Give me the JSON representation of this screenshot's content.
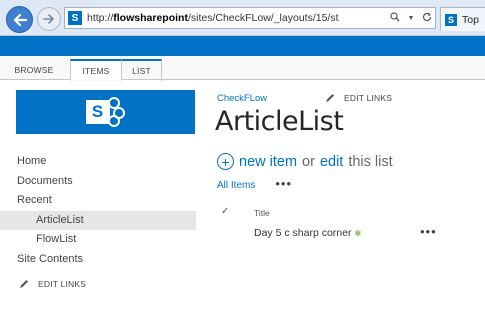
{
  "browser": {
    "url_prefix": "http://",
    "url_domain": "flowsharepoint",
    "url_rest": "/sites/CheckFLow/_layouts/15/st",
    "search_icon": "search-icon",
    "refresh_icon": "refresh-icon",
    "tab_label": "Top",
    "favicon_letter": "S"
  },
  "ribbon": {
    "tabs": [
      "BROWSE",
      "ITEMS",
      "LIST"
    ]
  },
  "site": {
    "logo_letter": "S",
    "crumb": "CheckFLow",
    "edit_links": "EDIT LINKS"
  },
  "quicklaunch": {
    "items": [
      "Home",
      "Documents",
      "Recent",
      "ArticleList",
      "FlowList",
      "Site Contents"
    ],
    "edit_links": "EDIT LINKS"
  },
  "main": {
    "page_title": "ArticleList",
    "new_item": "new item",
    "or": "or",
    "edit": "edit",
    "this_list": "this list",
    "plus": "+",
    "view_name": "All Items",
    "view_more": "•••",
    "header_check": "✓",
    "header_title": "Title",
    "rows": [
      {
        "title": "Day 5 c sharp corner",
        "badge": "✻",
        "menu": "•••"
      }
    ]
  },
  "colors": {
    "accent": "#0072c6",
    "suite_bar": "#0072c6",
    "new_badge": "#4aa02c",
    "selected_nav": "#e6e6e6"
  }
}
